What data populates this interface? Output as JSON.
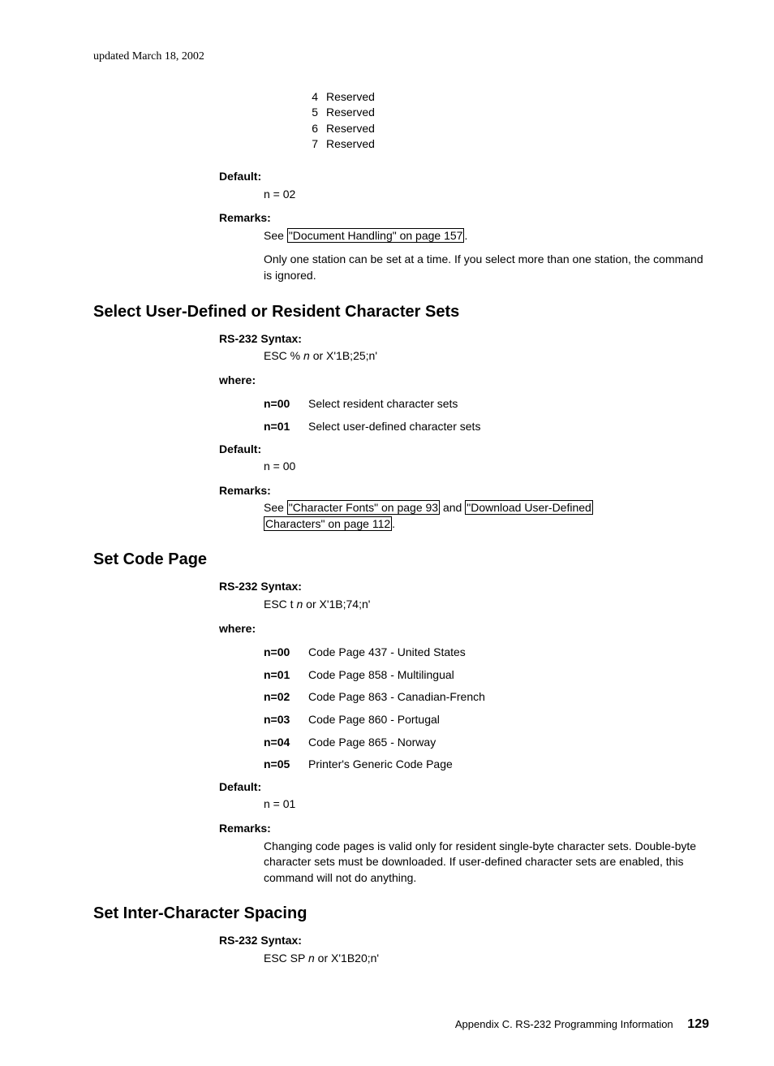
{
  "updated": "updated March 18, 2002",
  "numlist": [
    {
      "n": "4",
      "t": "Reserved"
    },
    {
      "n": "5",
      "t": "Reserved"
    },
    {
      "n": "6",
      "t": "Reserved"
    },
    {
      "n": "7",
      "t": "Reserved"
    }
  ],
  "s0": {
    "default_label": "Default:",
    "default_val": "n = 02",
    "remarks_label": "Remarks:",
    "remarks_see": "See ",
    "remarks_link": "\"Document Handling\" on page 157",
    "remarks_after": ".",
    "remarks_para": "Only one station can be set at a time. If you select more than one station, the command is ignored."
  },
  "h1": "Select User-Defined or Resident Character Sets",
  "s1": {
    "syntax_label": "RS-232 Syntax:",
    "syntax_pre": "ESC % ",
    "syntax_n": "n",
    "syntax_post": " or X'1B;25;n'",
    "where_label": "where:",
    "rows": [
      {
        "k": "n=00",
        "v": "Select resident character sets"
      },
      {
        "k": "n=01",
        "v": "Select user-defined character sets"
      }
    ],
    "default_label": "Default:",
    "default_val": "n = 00",
    "remarks_label": "Remarks:",
    "remarks_see": "See ",
    "remarks_link1": "\"Character Fonts\" on page 93",
    "remarks_and": " and ",
    "remarks_link2a": "\"Download User-Defined",
    "remarks_link2b": "Characters\" on page 112",
    "remarks_after": "."
  },
  "h2": "Set Code Page",
  "s2": {
    "syntax_label": "RS-232 Syntax:",
    "syntax_pre": "ESC t ",
    "syntax_n": "n",
    "syntax_post": " or X'1B;74;n'",
    "where_label": "where:",
    "rows": [
      {
        "k": "n=00",
        "v": "Code Page 437 - United States"
      },
      {
        "k": "n=01",
        "v": "Code Page 858 - Multilingual"
      },
      {
        "k": "n=02",
        "v": "Code Page 863 - Canadian-French"
      },
      {
        "k": "n=03",
        "v": "Code Page 860 - Portugal"
      },
      {
        "k": "n=04",
        "v": "Code Page 865 - Norway"
      },
      {
        "k": "n=05",
        "v": "Printer's Generic Code Page"
      }
    ],
    "default_label": "Default:",
    "default_val": "n = 01",
    "remarks_label": "Remarks:",
    "remarks_para": "Changing code pages is valid only for resident single-byte character sets. Double-byte character sets must be downloaded. If user-defined character sets are enabled, this command will not do anything."
  },
  "h3": "Set Inter-Character Spacing",
  "s3": {
    "syntax_label": "RS-232 Syntax:",
    "syntax_pre": "ESC SP ",
    "syntax_n": "n",
    "syntax_post": " or X'1B20;n'"
  },
  "footer": {
    "text": "Appendix C. RS-232 Programming Information",
    "page": "129"
  }
}
